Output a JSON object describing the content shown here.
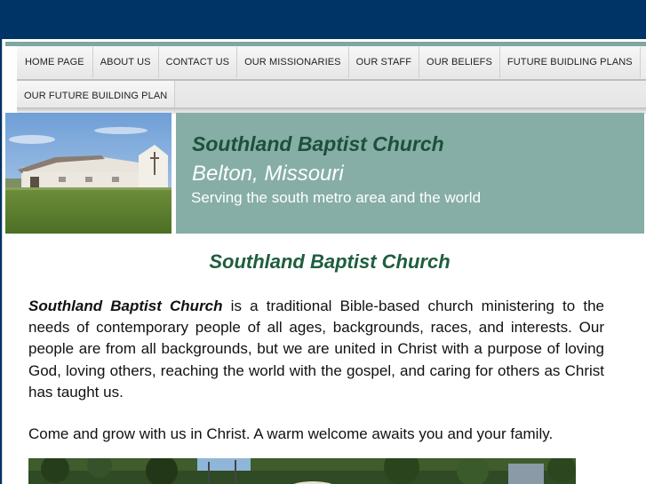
{
  "nav": {
    "row1": [
      "HOME PAGE",
      "ABOUT US",
      "CONTACT US",
      "OUR MISSIONARIES",
      "OUR STAFF",
      "OUR BELIEFS",
      "FUTURE BUIDLING PLANS"
    ],
    "row2": [
      "OUR FUTURE BUILDING PLAN"
    ]
  },
  "header": {
    "title": "Southland Baptist Church",
    "location": "Belton, Missouri",
    "tagline": "Serving the south metro area and the world"
  },
  "content": {
    "title": "Southland Baptist Church",
    "intro_name": "Southland Baptist Church",
    "intro_rest": " is a traditional Bible-based church ministering to the needs of contemporary people of all ages, backgrounds, races, and interests. Our people are from all backgrounds, but we are united in Christ with a purpose of loving God, loving others, reaching the world with the gospel, and caring for others as Christ has taught us.",
    "welcome": "Come and grow with us in Christ. A warm welcome awaits you and your family."
  },
  "colors": {
    "page_background": "#003366",
    "banner": "#86aea6",
    "title_green": "#1e5e3e"
  }
}
